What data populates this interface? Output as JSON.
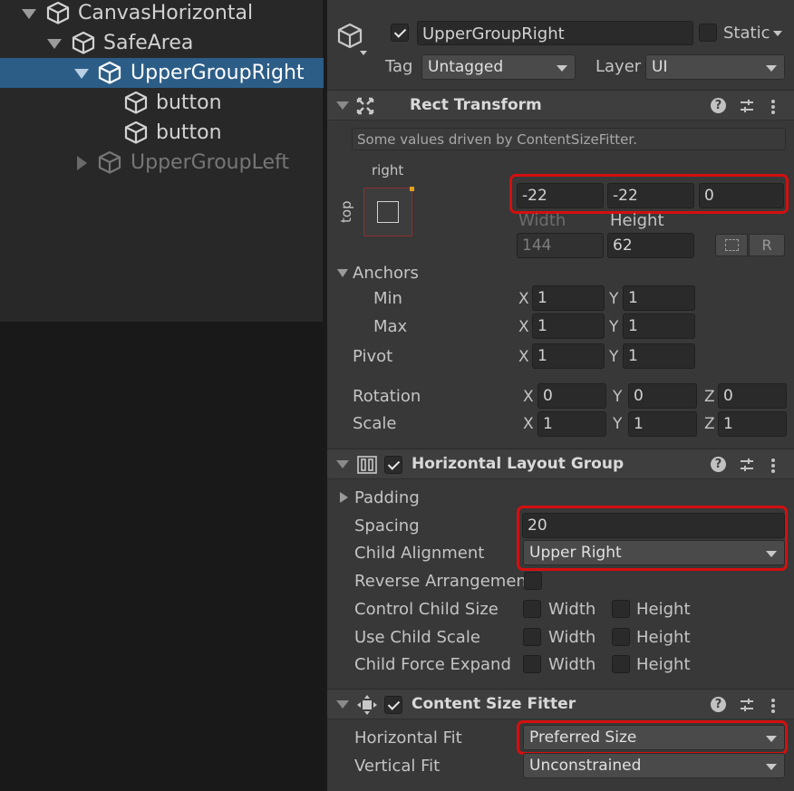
{
  "hierarchy": {
    "items": [
      {
        "label": "CanvasHorizontal"
      },
      {
        "label": "SafeArea"
      },
      {
        "label": "UpperGroupRight"
      },
      {
        "label": "button"
      },
      {
        "label": "button"
      },
      {
        "label": "UpperGroupLeft"
      }
    ]
  },
  "inspector": {
    "header": {
      "object_name": "UpperGroupRight",
      "active": true,
      "static_label": "Static",
      "tag_label": "Tag",
      "tag_value": "Untagged",
      "layer_label": "Layer",
      "layer_value": "UI"
    },
    "rect_transform": {
      "title": "Rect Transform",
      "driven_note": "Some values driven by ContentSizeFitter.",
      "anchor_h_label": "right",
      "anchor_v_label": "top",
      "pos_x": "-22",
      "pos_y": "-22",
      "pos_z": "0",
      "width_label": "Width",
      "height_label": "Height",
      "width_value": "144",
      "height_value": "62",
      "raw_button": "R",
      "anchors_label": "Anchors",
      "min_label": "Min",
      "max_label": "Max",
      "min_x": "1",
      "min_y": "1",
      "max_x": "1",
      "max_y": "1",
      "pivot_label": "Pivot",
      "pivot_x": "1",
      "pivot_y": "1",
      "rotation_label": "Rotation",
      "rot_x": "0",
      "rot_y": "0",
      "rot_z": "0",
      "scale_label": "Scale",
      "scale_x": "1",
      "scale_y": "1",
      "scale_z": "1",
      "x": "X",
      "y": "Y",
      "z": "Z"
    },
    "hlg": {
      "title": "Horizontal Layout Group",
      "enabled": true,
      "padding_label": "Padding",
      "spacing_label": "Spacing",
      "spacing_value": "20",
      "child_alignment_label": "Child Alignment",
      "child_alignment_value": "Upper Right",
      "reverse_label": "Reverse Arrangement",
      "control_child_size_label": "Control Child Size",
      "use_child_scale_label": "Use Child Scale",
      "child_force_expand_label": "Child Force Expand",
      "width_label": "Width",
      "height_label": "Height"
    },
    "csf": {
      "title": "Content Size Fitter",
      "enabled": true,
      "horizontal_fit_label": "Horizontal Fit",
      "horizontal_fit_value": "Preferred Size",
      "vertical_fit_label": "Vertical Fit",
      "vertical_fit_value": "Unconstrained"
    },
    "help_glyph": "?"
  },
  "colors": {
    "selection": "#2c5d87",
    "highlight": "#d40f0f",
    "panel": "#383838",
    "field": "#2a2a2a"
  }
}
